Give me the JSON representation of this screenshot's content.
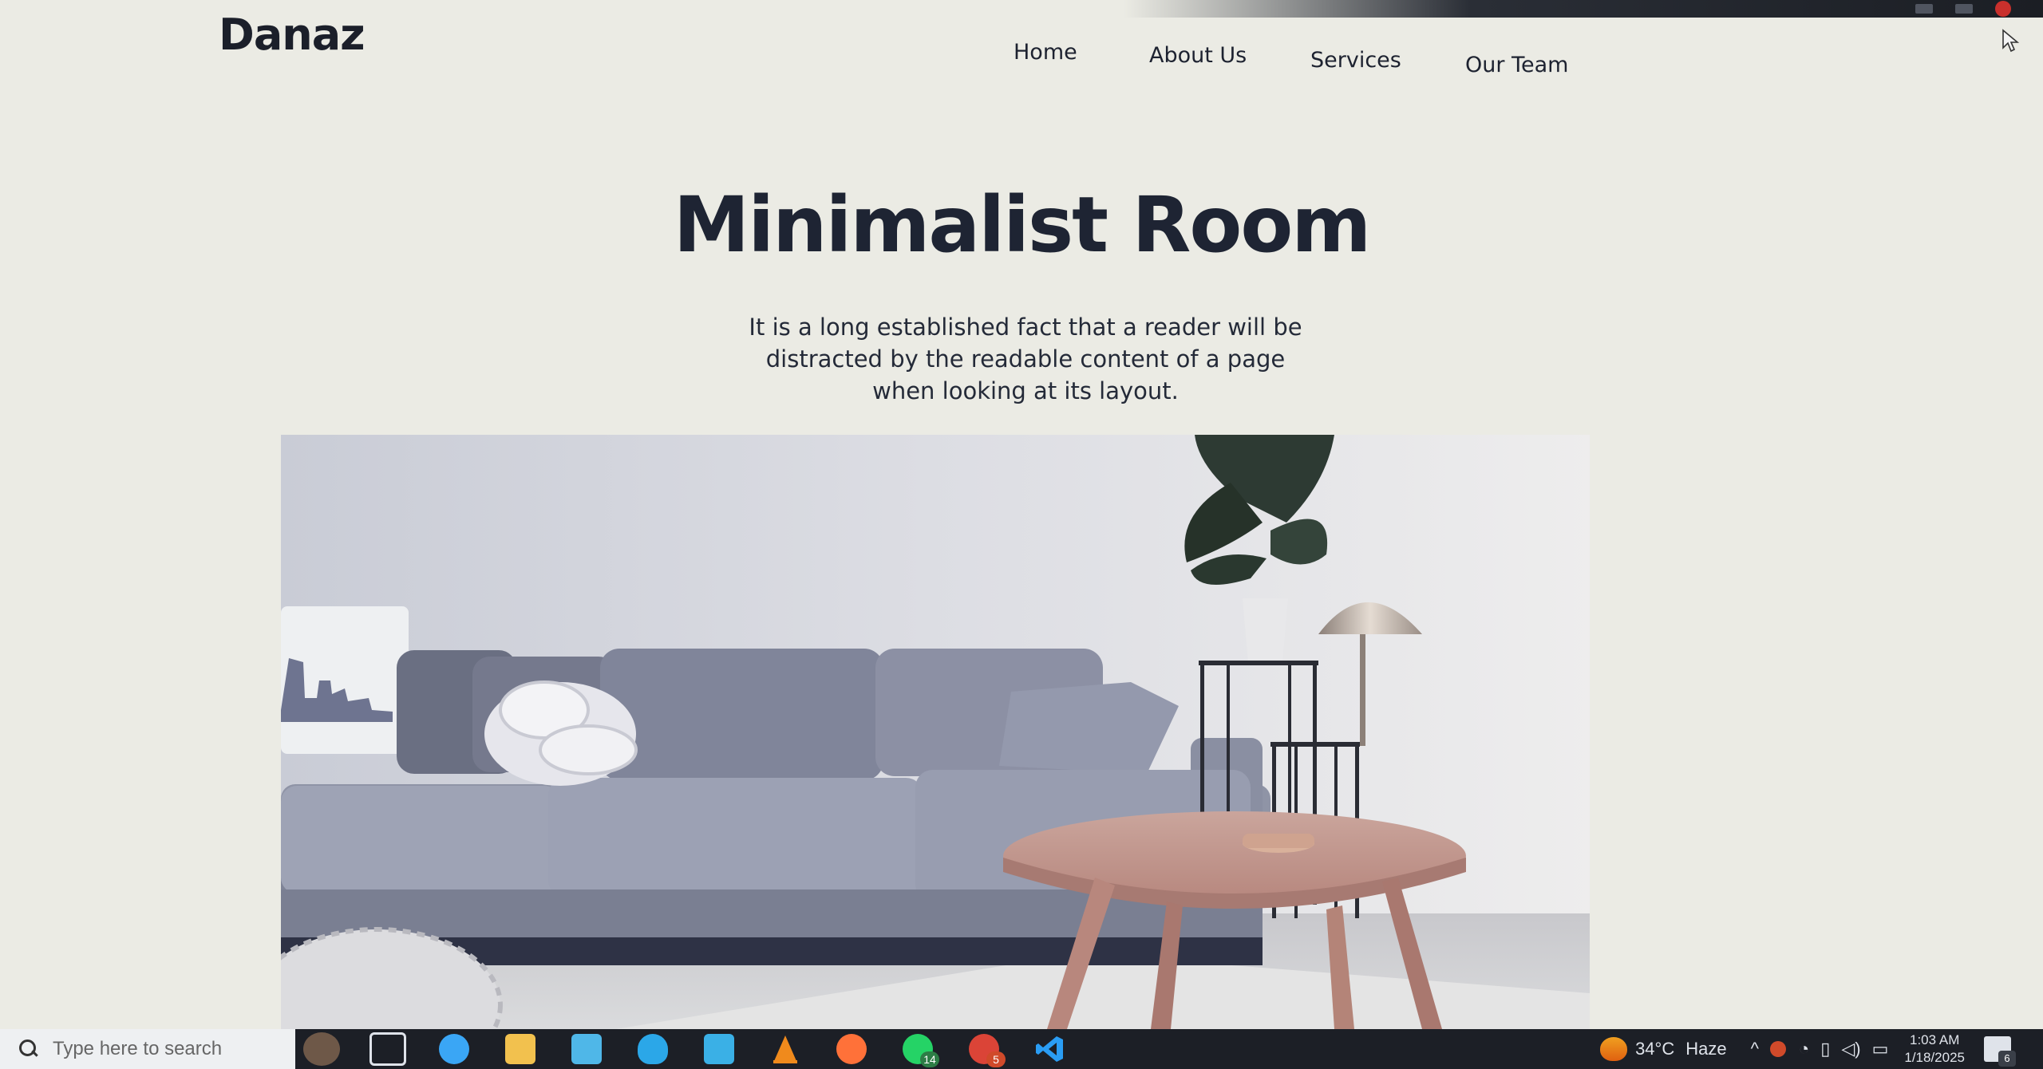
{
  "site": {
    "logo": "Danaz",
    "nav": [
      "Home",
      "About Us",
      "Services",
      "Our Team"
    ]
  },
  "hero": {
    "title": "Minimalist Room",
    "text": "It is a long established fact that a reader will be distracted by the readable content of a page when looking at its layout."
  },
  "taskbar": {
    "search_placeholder": "Type here to search",
    "icons": [
      {
        "name": "people-icon",
        "color": "#6e5848"
      },
      {
        "name": "task-view-icon",
        "color": "#dfe3ea"
      },
      {
        "name": "copilot-icon",
        "color": "#3aa6f5"
      },
      {
        "name": "file-explorer-icon",
        "color": "#f2c14e"
      },
      {
        "name": "store-icon",
        "color": "#4fb7e8"
      },
      {
        "name": "health-app-icon",
        "color": "#2ba7e8"
      },
      {
        "name": "mail-icon",
        "color": "#3ab0e6"
      },
      {
        "name": "vlc-icon",
        "color": "#f08a1c"
      },
      {
        "name": "firefox-icon",
        "color": "#ff7139"
      },
      {
        "name": "whatsapp-icon",
        "color": "#25d366",
        "badge": "14"
      },
      {
        "name": "chrome-icon",
        "color": "#db4437",
        "badge": "5"
      },
      {
        "name": "vscode-icon",
        "color": "#2a9df4"
      }
    ],
    "weather": {
      "temp": "34°C",
      "condition": "Haze"
    },
    "time": "1:03 AM",
    "date": "1/18/2025",
    "notification_count": "6"
  },
  "colors": {
    "page_bg": "#ebebe4",
    "heading": "#1e2433",
    "taskbar": "#1c1f26"
  }
}
